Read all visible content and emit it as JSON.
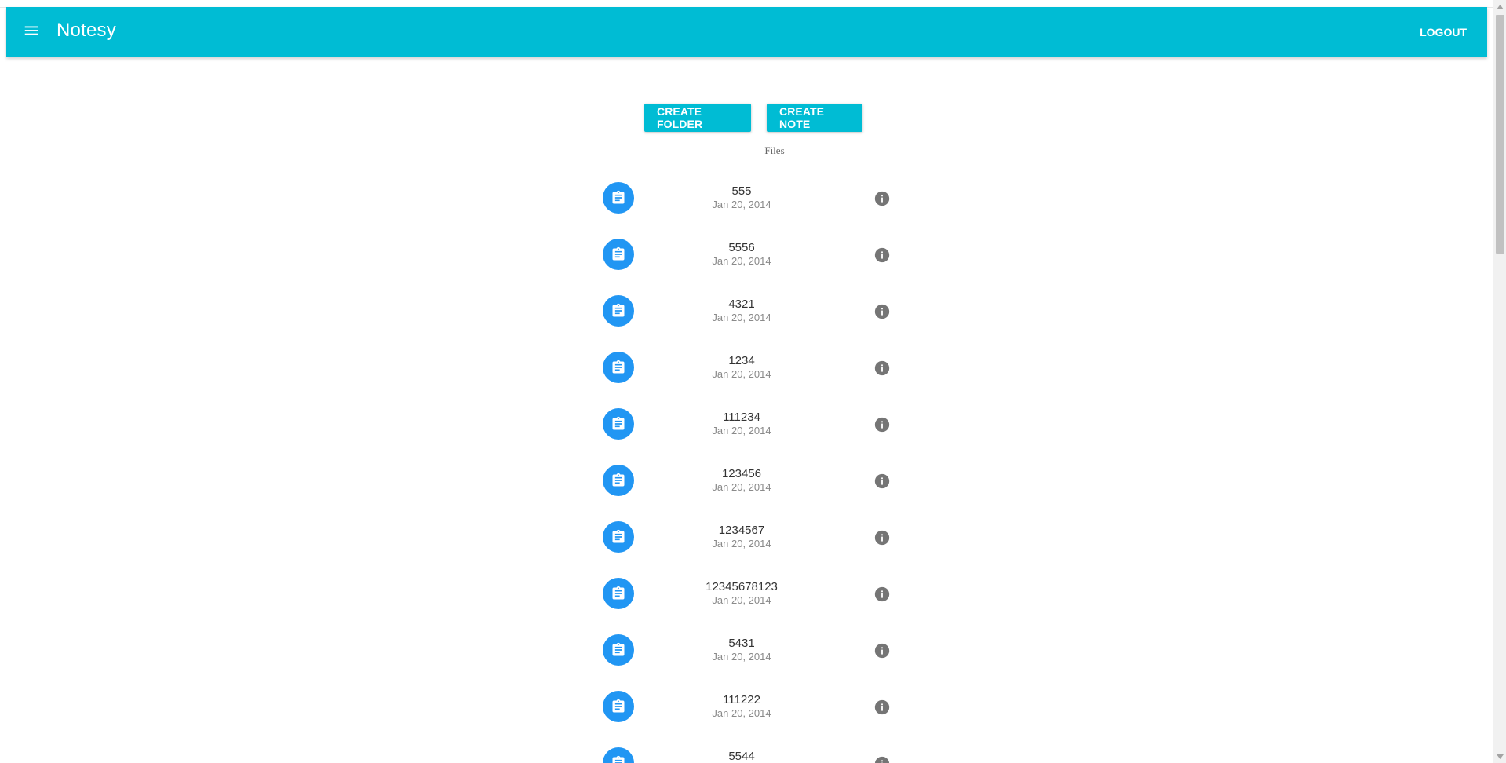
{
  "app": {
    "title": "Notesy",
    "logout_label": "LOGOUT",
    "menu_icon": "menu-icon",
    "brand_color": "#00bcd4",
    "accent_color": "#2196f3"
  },
  "toolbar": {
    "create_folder_label": "CREATE FOLDER",
    "create_note_label": "CREATE NOTE"
  },
  "files": {
    "heading": "Files",
    "items": [
      {
        "name": "555",
        "date": "Jan 20, 2014",
        "icon": "clipboard-icon"
      },
      {
        "name": "5556",
        "date": "Jan 20, 2014",
        "icon": "clipboard-icon"
      },
      {
        "name": "4321",
        "date": "Jan 20, 2014",
        "icon": "clipboard-icon"
      },
      {
        "name": "1234",
        "date": "Jan 20, 2014",
        "icon": "clipboard-icon"
      },
      {
        "name": "111234",
        "date": "Jan 20, 2014",
        "icon": "clipboard-icon"
      },
      {
        "name": "123456",
        "date": "Jan 20, 2014",
        "icon": "clipboard-icon"
      },
      {
        "name": "1234567",
        "date": "Jan 20, 2014",
        "icon": "clipboard-icon"
      },
      {
        "name": "12345678123",
        "date": "Jan 20, 2014",
        "icon": "clipboard-icon"
      },
      {
        "name": "5431",
        "date": "Jan 20, 2014",
        "icon": "clipboard-icon"
      },
      {
        "name": "111222",
        "date": "Jan 20, 2014",
        "icon": "clipboard-icon"
      },
      {
        "name": "5544",
        "date": "",
        "icon": "clipboard-icon"
      }
    ]
  }
}
